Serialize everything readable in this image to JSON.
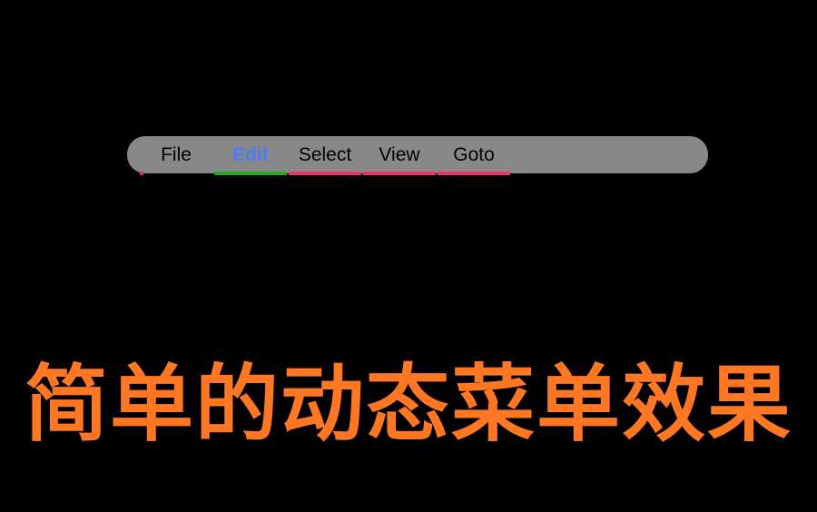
{
  "menu": {
    "items": [
      {
        "label": "File",
        "hovered": false,
        "underlineColor": "#ee3366",
        "underlineWidth": "partial"
      },
      {
        "label": "Edit",
        "hovered": true,
        "underlineColor": "#22aa22",
        "underlineWidth": "full"
      },
      {
        "label": "Select",
        "hovered": false,
        "underlineColor": "#ee3366",
        "underlineWidth": "full"
      },
      {
        "label": "View",
        "hovered": false,
        "underlineColor": "#ee3366",
        "underlineWidth": "full"
      },
      {
        "label": "Goto",
        "hovered": false,
        "underlineColor": "#ee3366",
        "underlineWidth": "full"
      }
    ]
  },
  "title": "简单的动态菜单效果",
  "colors": {
    "background": "#000000",
    "menuBar": "#888888",
    "menuText": "#000000",
    "menuHovered": "#4a7bff",
    "underlineDefault": "#ee3366",
    "underlineActive": "#22aa22",
    "titleText": "#ff7722"
  }
}
